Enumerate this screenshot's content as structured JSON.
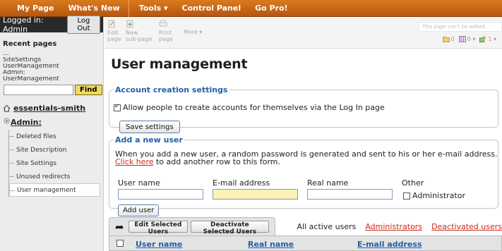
{
  "topnav": {
    "items": [
      "My Page",
      "What's New",
      "Tools ▾",
      "Control Panel",
      "Go Pro!"
    ]
  },
  "sidebar": {
    "logged_in": "Logged in: Admin",
    "logout_label": "Log Out",
    "recent_title": "Recent pages",
    "recent_items": [
      "...",
      "SiteSettings",
      "UserManagement",
      "Admin:",
      "UserManagement"
    ],
    "find_label": "Find",
    "tree_root": "essentials-smith",
    "tree_admin": "Admin:",
    "tree_children": [
      "Deleted files",
      "Site Description",
      "Site Settings",
      "Unused redirects",
      "User management"
    ]
  },
  "toolbar": {
    "edit_label": "Edit page",
    "edit_line1": "Edit",
    "edit_line2": "page",
    "new_line1": "New",
    "new_line2": "sub-page",
    "print_line1": "Print",
    "print_line2": "page",
    "more_label": "More ▾",
    "edit_notice": "This page can't be edited.",
    "count1": "0",
    "count2": "0 ▾",
    "count3": "1 ▾"
  },
  "main": {
    "title": "User management",
    "account_settings": {
      "legend": "Account creation settings",
      "allow_label": "Allow people to create accounts for themselves via the Log In page",
      "allow_checked": true,
      "save_label": "Save settings"
    },
    "add_user": {
      "legend": "Add a new user",
      "desc_line1": "When you add a new user, a random password is generated and sent to his or her e-mail address.",
      "click_here": "Click here",
      "desc_line2_rest": " to add another row to this form.",
      "col_username": "User name",
      "col_email": "E-mail address",
      "col_realname": "Real name",
      "col_other": "Other",
      "admin_label": "Administrator",
      "add_label": "Add user"
    },
    "users": {
      "edit_selected": "Edit Selected Users",
      "deactivate_selected": "Deactivate Selected Users",
      "filter_active": "All active users",
      "filter_admins": "Administrators",
      "filter_deactivated": "Deactivated users",
      "col_user": "User name",
      "col_real": "Real name",
      "col_email": "E-mail address"
    }
  },
  "colors": {
    "nav_orange": "#c8661a",
    "accent_blue": "#235fa8",
    "link_red": "#cc2a1f",
    "email_field_yellow": "#fbf3b3"
  }
}
